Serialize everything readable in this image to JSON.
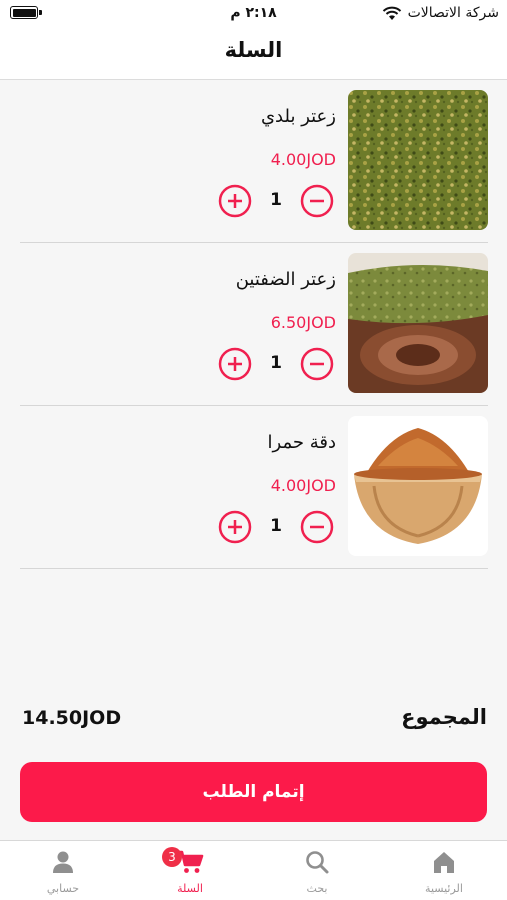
{
  "status_bar": {
    "carrier": "شركة الاتصالات",
    "time": "٢:١٨ م",
    "battery_level": 1.0
  },
  "header": {
    "title": "السلة"
  },
  "cart": {
    "items": [
      {
        "name": "زعتر بلدي",
        "price": "4.00JOD",
        "quantity": "1",
        "image": "green-zaatar-photo"
      },
      {
        "name": "زعتر الضفتين",
        "price": "6.50JOD",
        "quantity": "1",
        "image": "zaatar-wooden-bowl-photo"
      },
      {
        "name": "دقة حمرا",
        "price": "4.00JOD",
        "quantity": "1",
        "image": "red-dukkah-bowl-photo"
      }
    ],
    "total_label": "المجموع",
    "total_value": "14.50JOD",
    "checkout_label": "إتمام الطلب"
  },
  "tabbar": {
    "tabs": [
      {
        "label": "الرئيسية",
        "icon": "home-icon",
        "active": false
      },
      {
        "label": "بحث",
        "icon": "search-icon",
        "active": false
      },
      {
        "label": "السلة",
        "icon": "cart-icon",
        "active": true,
        "badge": "3"
      },
      {
        "label": "حسابي",
        "icon": "user-icon",
        "active": false
      }
    ]
  },
  "colors": {
    "accent": "#fc1a4a",
    "price": "#f0204f",
    "inactive_tab": "#9a9a9a"
  }
}
